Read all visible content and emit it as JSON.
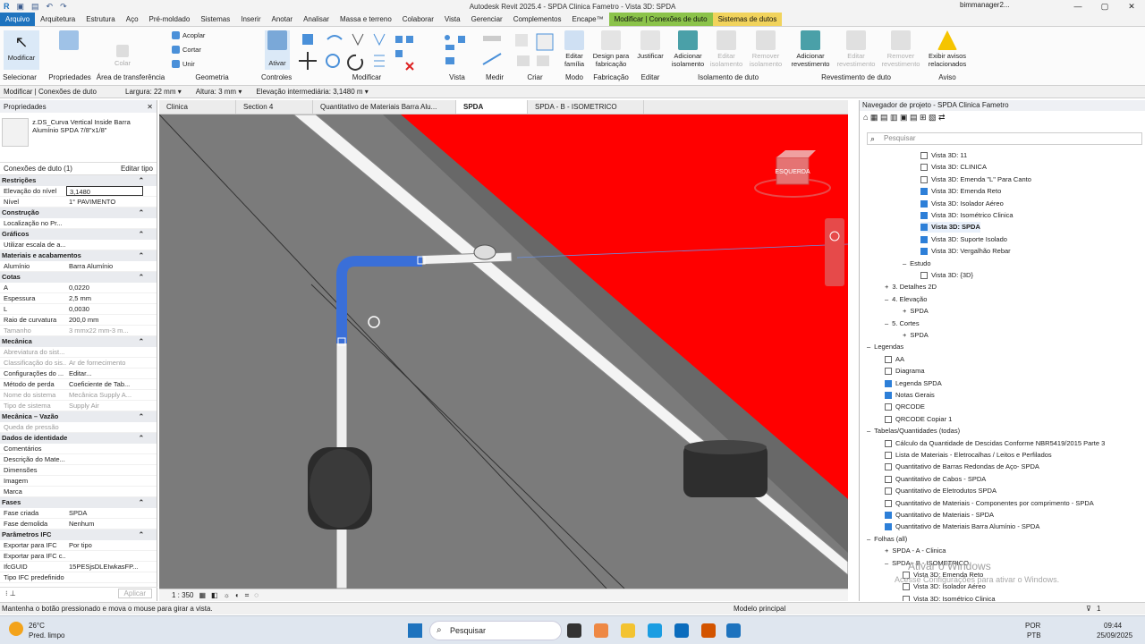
{
  "window": {
    "title": "Autodesk Revit 2025.4 - SPDA Clinica Fametro - Vista 3D: SPDA",
    "user": "bimmanager2..."
  },
  "tabs": [
    "Arquivo",
    "Arquitetura",
    "Estrutura",
    "Aço",
    "Pré-moldado",
    "Sistemas",
    "Inserir",
    "Anotar",
    "Analisar",
    "Massa e terreno",
    "Colaborar",
    "Vista",
    "Gerenciar",
    "Complementos",
    "Encape™",
    "Modificar | Conexões de duto",
    "Sistemas de dutos"
  ],
  "ribbon": {
    "modificar": "Modificar",
    "colar": "Colar",
    "acoplar": "Acoplar",
    "cortar": "Cortar",
    "unir": "Unir",
    "ativar": "Ativar",
    "editar_familia": "Editar família",
    "design_fabricacao": "Design para fabricação",
    "justificar": "Justificar",
    "adicionar_isolamento": "Adicionar isolamento",
    "editar_isolamento": "Editar isolamento",
    "remover_isolamento": "Remover isolamento",
    "adicionar_revestimento": "Adicionar revestimento",
    "editar_revestimento": "Editar revestimento",
    "remover_revestimento": "Remover revestimento",
    "exibir_avisos": "Exibir avisos relacionados",
    "groups": [
      "Selecionar",
      "Propriedades",
      "Área de transferência",
      "Geometria",
      "Controles",
      "Modificar",
      "Vista",
      "Medir",
      "Criar",
      "Modo",
      "Fabricação",
      "Editar",
      "Isolamento de duto",
      "Revestimento de duto",
      "Aviso"
    ]
  },
  "optionsbar": {
    "context": "Modificar | Conexões de duto",
    "largura_label": "Largura:",
    "largura": "22 mm",
    "altura_label": "Altura:",
    "altura": "3 mm",
    "elev_label": "Elevação intermediária:",
    "elev": "3,1480 m"
  },
  "properties": {
    "title": "Propriedades",
    "type_name": "z.DS_Curva Vertical Inside Barra Alumínio SPDA 7/8\"x1/8\"",
    "selection": "Conexões de duto (1)",
    "edit_type": "Editar tipo",
    "apply": "Aplicar",
    "sections": [
      {
        "name": "Restrições",
        "rows": [
          [
            "Elevação do nível",
            "3,1480",
            false
          ],
          [
            "Nível",
            "1° PAVIMENTO",
            false
          ]
        ]
      },
      {
        "name": "Construção",
        "rows": [
          [
            "Localização no Pr...",
            "",
            false
          ]
        ]
      },
      {
        "name": "Gráficos",
        "rows": [
          [
            "Utilizar escala de a...",
            "",
            false
          ]
        ]
      },
      {
        "name": "Materiais e acabamentos",
        "rows": [
          [
            "Alumínio",
            "Barra Alumínio",
            false
          ]
        ]
      },
      {
        "name": "Cotas",
        "rows": [
          [
            "A",
            "0,0220",
            false
          ],
          [
            "Espessura",
            "2,5 mm",
            false
          ],
          [
            "L",
            "0,0030",
            false
          ],
          [
            "Raio de curvatura",
            "200,0 mm",
            false
          ],
          [
            "Tamanho",
            "3 mmx22 mm-3 m...",
            true
          ]
        ]
      },
      {
        "name": "Mecânica",
        "rows": [
          [
            "Abreviatura do sist...",
            "",
            true
          ],
          [
            "Classificação do sis...",
            "Ar de fornecimento",
            true
          ],
          [
            "Configurações do ...",
            "Editar...",
            false
          ],
          [
            "Método de perda",
            "Coeficiente de Tab...",
            false
          ],
          [
            "Nome do sistema",
            "Mecânica Supply A...",
            true
          ],
          [
            "Tipo de sistema",
            "Supply Air",
            true
          ]
        ]
      },
      {
        "name": "Mecânica – Vazão",
        "rows": [
          [
            "Queda de pressão",
            "",
            true
          ]
        ]
      },
      {
        "name": "Dados de identidade",
        "rows": [
          [
            "Comentários",
            "",
            false
          ],
          [
            "Descrição do Mate...",
            "",
            false
          ],
          [
            "Dimensões",
            "",
            false
          ],
          [
            "Imagem",
            "",
            false
          ],
          [
            "Marca",
            "",
            false
          ]
        ]
      },
      {
        "name": "Fases",
        "rows": [
          [
            "Fase criada",
            "SPDA",
            false
          ],
          [
            "Fase demolida",
            "Nenhum",
            false
          ]
        ]
      },
      {
        "name": "Parâmetros IFC",
        "rows": [
          [
            "Exportar para IFC",
            "Por tipo",
            false
          ],
          [
            "Exportar para IFC c...",
            "",
            false
          ],
          [
            "IfcGUID",
            "15PESjsDLEIwkasFP...",
            false
          ],
          [
            "Tipo IFC predefinido",
            "",
            false
          ]
        ]
      }
    ]
  },
  "viewtabs": [
    "Clinica",
    "Section 4",
    "Quantitativo de Materiais Barra Alu...",
    "SPDA",
    "SPDA - B - ISOMETRICO"
  ],
  "view": {
    "scale": "1 : 350",
    "cube_label": "ESQUERDA"
  },
  "navigator": {
    "title": "Navegador de projeto - SPDA Clinica Fametro",
    "search": "Pesquisar",
    "items": [
      [
        "Vista 3D: 11",
        3,
        false,
        "w"
      ],
      [
        "Vista 3D: CLINICA",
        3,
        false,
        "w"
      ],
      [
        "Vista 3D: Emenda \"L\" Para Canto",
        3,
        false,
        "w"
      ],
      [
        "Vista 3D: Emenda Reto",
        3,
        false,
        "b"
      ],
      [
        "Vista 3D: Isolador Aéreo",
        3,
        false,
        "b"
      ],
      [
        "Vista 3D: Isométrico Clinica",
        3,
        false,
        "b"
      ],
      [
        "Vista 3D: SPDA",
        3,
        true,
        "b"
      ],
      [
        "Vista 3D: Suporte Isolado",
        3,
        false,
        "b"
      ],
      [
        "Vista 3D: Vergalhão Rebar",
        3,
        false,
        "b"
      ],
      [
        "Estudo",
        2,
        false,
        "-"
      ],
      [
        "Vista 3D: {3D}",
        3,
        false,
        "w"
      ],
      [
        "3. Detalhes 2D",
        1,
        false,
        "+"
      ],
      [
        "4. Elevação",
        1,
        false,
        "-"
      ],
      [
        "SPDA",
        2,
        false,
        "+"
      ],
      [
        "5. Cortes",
        1,
        false,
        "-"
      ],
      [
        "SPDA",
        2,
        false,
        "+"
      ],
      [
        "Legendas",
        0,
        false,
        "-"
      ],
      [
        "AA",
        1,
        false,
        "w"
      ],
      [
        "Diagrama",
        1,
        false,
        "w"
      ],
      [
        "Legenda SPDA",
        1,
        false,
        "b"
      ],
      [
        "Notas Gerais",
        1,
        false,
        "b"
      ],
      [
        "QRCODE",
        1,
        false,
        "w"
      ],
      [
        "QRCODE Copiar 1",
        1,
        false,
        "w"
      ],
      [
        "Tabelas/Quantidades (todas)",
        0,
        false,
        "-"
      ],
      [
        "Cálculo da Quantidade de Descidas Conforme NBR5419/2015 Parte 3",
        1,
        false,
        "w"
      ],
      [
        "Lista de Materiais - Eletrocalhas / Leitos e Perfilados",
        1,
        false,
        "w"
      ],
      [
        "Quantitativo de Barras Redondas de Aço- SPDA",
        1,
        false,
        "w"
      ],
      [
        "Quantitativo de Cabos - SPDA",
        1,
        false,
        "w"
      ],
      [
        "Quantitativo de Eletrodutos SPDA",
        1,
        false,
        "w"
      ],
      [
        "Quantitativo de Materiais - Componentes por comprimento - SPDA",
        1,
        false,
        "w"
      ],
      [
        "Quantitativo de Materiais - SPDA",
        1,
        false,
        "b"
      ],
      [
        "Quantitativo de Materiais Barra Alumínio - SPDA",
        1,
        false,
        "b"
      ],
      [
        "Folhas (all)",
        0,
        false,
        "-"
      ],
      [
        "SPDA - A - Clinica",
        1,
        false,
        "+"
      ],
      [
        "SPDA - B - ISOMETRICO",
        1,
        false,
        "-"
      ],
      [
        "Vista 3D: Emenda Reto",
        2,
        false,
        "w"
      ],
      [
        "Vista 3D: Isolador Aéreo",
        2,
        false,
        "w"
      ],
      [
        "Vista 3D: Isométrico Clinica",
        2,
        false,
        "w"
      ]
    ]
  },
  "status": {
    "hint": "Mantenha o botão pressionado e mova o mouse para girar a vista.",
    "model": "Modelo principal",
    "filter": "1"
  },
  "taskbar": {
    "weather_temp": "26°C",
    "weather_desc": "Pred. limpo",
    "search": "Pesquisar",
    "lang": "POR",
    "layout": "PTB",
    "time": "09:44",
    "date": "25/09/2025"
  },
  "watermark": {
    "line1": "Ativar o Windows",
    "line2": "Acesse Configurações para ativar o Windows."
  },
  "colors": {
    "file_tab": "#1e73be",
    "context_tab": "#8bc34a",
    "systems_tab": "#f1d35c",
    "red_surface": "#ff0000",
    "selected_duct": "#3a6fd8"
  }
}
